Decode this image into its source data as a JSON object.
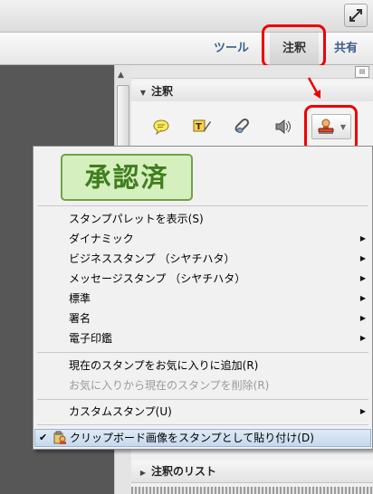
{
  "toolbar": {
    "tools": "ツール",
    "comment": "注釈",
    "share": "共有"
  },
  "panel": {
    "section_title": "注釈",
    "list_title": "注釈のリスト",
    "icons": [
      "speech-bubble-icon",
      "text-edit-icon",
      "attach-icon",
      "audio-icon",
      "stamp-icon"
    ]
  },
  "menu": {
    "stamp_preview": "承認済",
    "items": [
      {
        "label": "スタンプパレットを表示(S)",
        "submenu": false,
        "disabled": false
      },
      {
        "label": "ダイナミック",
        "submenu": true,
        "disabled": false
      },
      {
        "label": "ビジネススタンプ （シヤチハタ）",
        "submenu": true,
        "disabled": false
      },
      {
        "label": "メッセージスタンプ （シヤチハタ）",
        "submenu": true,
        "disabled": false
      },
      {
        "label": "標準",
        "submenu": true,
        "disabled": false
      },
      {
        "label": "署名",
        "submenu": true,
        "disabled": false
      },
      {
        "label": "電子印鑑",
        "submenu": true,
        "disabled": false
      },
      {
        "label": "現在のスタンプをお気に入りに追加(R)",
        "submenu": false,
        "disabled": false
      },
      {
        "label": "お気に入りから現在のスタンプを削除(R)",
        "submenu": false,
        "disabled": true
      },
      {
        "label": "カスタムスタンプ(U)",
        "submenu": true,
        "disabled": false
      },
      {
        "label": "クリップボード画像をスタンプとして貼り付け(D)",
        "submenu": false,
        "disabled": false,
        "checked": true
      }
    ]
  },
  "colors": {
    "highlight": "#ee0000",
    "stamp_green": "#3e7e1e",
    "link_blue": "#3a5f8a"
  }
}
